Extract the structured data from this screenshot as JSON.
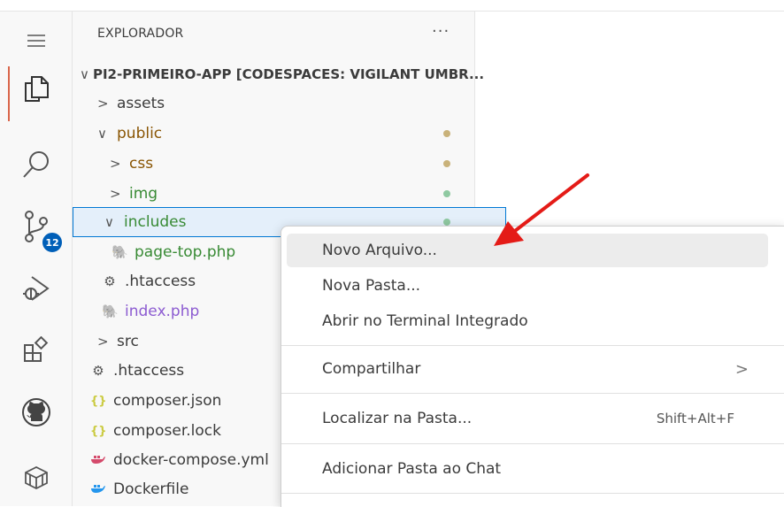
{
  "explorer": {
    "title": "EXPLORADOR",
    "more": "···",
    "root": "PI2-PRIMEIRO-APP [CODESPACES: VIGILANT UMBR...",
    "items": [
      {
        "label": "assets",
        "chevron": ">",
        "status": "none"
      },
      {
        "label": "public",
        "chevron": "∨",
        "status": "modified"
      },
      {
        "label": "css",
        "chevron": ">",
        "status": "modified"
      },
      {
        "label": "img",
        "chevron": ">",
        "status": "added"
      },
      {
        "label": "includes",
        "chevron": "∨",
        "status": "added"
      },
      {
        "label": "page-top.php",
        "icon": "php-icon"
      },
      {
        "label": ".htaccess",
        "icon": "gear-icon"
      },
      {
        "label": "index.php",
        "icon": "php-icon"
      },
      {
        "label": "src",
        "chevron": ">"
      },
      {
        "label": ".htaccess",
        "icon": "gear-icon"
      },
      {
        "label": "composer.json",
        "icon": "braces-icon",
        "glyph": "{}"
      },
      {
        "label": "composer.lock",
        "icon": "braces-icon",
        "glyph": "{}"
      },
      {
        "label": "docker-compose.yml",
        "icon": "docker-icon"
      },
      {
        "label": "Dockerfile",
        "icon": "docker-icon"
      }
    ]
  },
  "activity": {
    "badge": "12",
    "icons": [
      "menu-icon",
      "files-icon",
      "search-icon",
      "source-control-icon",
      "run-debug-icon",
      "extensions-icon",
      "github-icon",
      "remote-explorer-icon"
    ]
  },
  "context_menu": {
    "new_file": "Novo Arquivo...",
    "new_folder": "Nova Pasta...",
    "open_terminal": "Abrir no Terminal Integrado",
    "share": "Compartilhar",
    "find_in_folder": "Localizar na Pasta...",
    "find_shortcut": "Shift+Alt+F",
    "add_to_chat": "Adicionar Pasta ao Chat",
    "submenu_chevron": ">"
  },
  "colors": {
    "modified": "#c9b27a",
    "added": "#8fc9a1",
    "accent": "#0078d4",
    "arrow": "#e41b17"
  }
}
